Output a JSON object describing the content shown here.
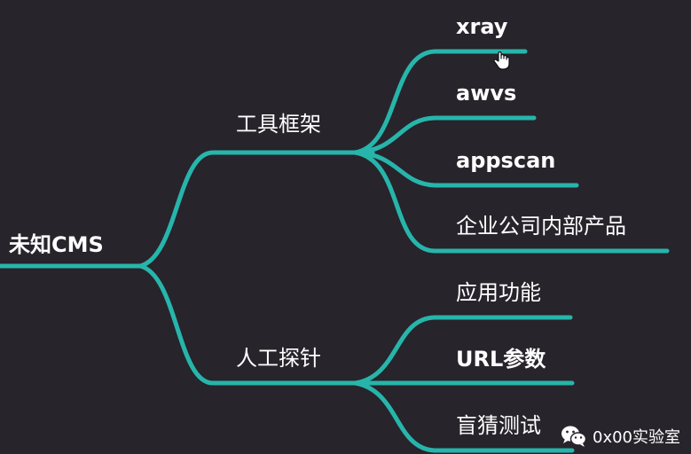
{
  "mindmap": {
    "root": {
      "label": "未知CMS"
    },
    "branches": [
      {
        "label": "工具框架",
        "children": [
          "xray",
          "awvs",
          "appscan",
          "企业公司内部产品"
        ]
      },
      {
        "label": "人工探针",
        "children": [
          "应用功能",
          "URL参数",
          "盲猜测试"
        ]
      }
    ]
  },
  "watermark": {
    "text": "0x00实验室"
  },
  "colors": {
    "background": "#27242b",
    "connector": "#27b5ab",
    "text": "#ffffff"
  },
  "icons": [
    "mouse-hand-cursor-icon",
    "wechat-logo-icon"
  ]
}
